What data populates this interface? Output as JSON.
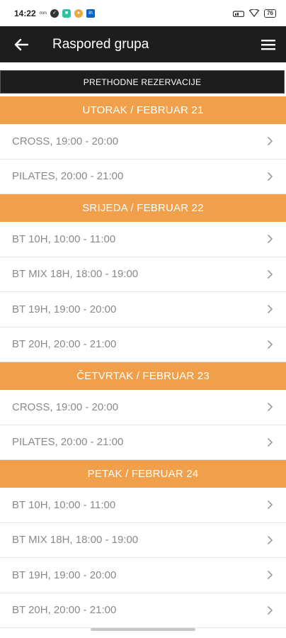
{
  "status": {
    "time": "14:22",
    "battery": "76"
  },
  "appbar": {
    "title": "Raspored grupa"
  },
  "previous_button": "PRETHODNE REZERVACIJE",
  "days": [
    {
      "header": "UTORAK / FEBRUAR 21",
      "sessions": [
        "CROSS, 19:00 - 20:00",
        "PILATES, 20:00 - 21:00"
      ]
    },
    {
      "header": "SRIJEDA / FEBRUAR 22",
      "sessions": [
        "BT 10H, 10:00 - 11:00",
        "BT MIX 18H, 18:00 - 19:00",
        "BT 19H, 19:00 - 20:00",
        "BT 20H, 20:00 - 21:00"
      ]
    },
    {
      "header": "ČETVRTAK / FEBRUAR 23",
      "sessions": [
        "CROSS, 19:00 - 20:00",
        "PILATES, 20:00 - 21:00"
      ]
    },
    {
      "header": "PETAK / FEBRUAR 24",
      "sessions": [
        "BT 10H, 10:00 - 11:00",
        "BT MIX 18H, 18:00 - 19:00",
        "BT 19H, 19:00 - 20:00",
        "BT 20H, 20:00 - 21:00"
      ]
    }
  ],
  "colors": {
    "accent": "#f0a04b",
    "appbar": "#1d1d1d"
  }
}
